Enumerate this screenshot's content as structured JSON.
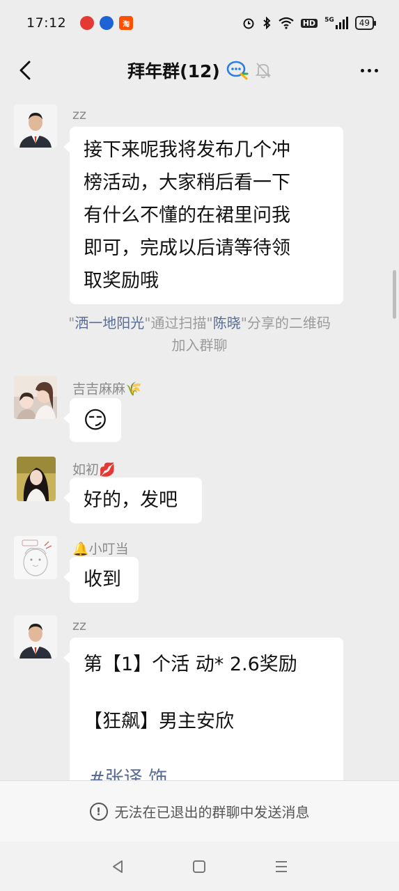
{
  "status_bar": {
    "time": "17:12",
    "battery": "49",
    "signal_label": "5G",
    "hd_label": "HD",
    "app_icon_taobao": "淘"
  },
  "header": {
    "title": "拜年群(12)"
  },
  "messages": [
    {
      "sender": "zz",
      "lines": [
        "接下来呢我将发布几个冲",
        "榜活动，大家稍后看一下",
        "有什么不懂的在裙里问我",
        "即可，完成以后请等待领",
        "取奖励哦"
      ]
    },
    {
      "sender": "吉吉麻麻🌾",
      "emoji": "😏"
    },
    {
      "sender": "如初💋",
      "text": "好的，发吧"
    },
    {
      "sender": "🔔小叮当",
      "text": "收到"
    },
    {
      "sender": "zz",
      "lines": [
        "第【1】个活 动* 2.6奖励",
        "",
        "【狂飙】男主安欣",
        "",
        "#张译  饰"
      ]
    }
  ],
  "system_note": {
    "quote1": "\"",
    "name1": "洒一地阳光",
    "mid1": "\"通过扫描\"",
    "name2": "陈晓",
    "mid2": "\"分享的二维码",
    "line2": "加入群聊"
  },
  "bottom_bar": {
    "text": "无法在已退出的群聊中发送消息",
    "icon_glyph": "!"
  },
  "colors": {
    "bubble": "#ffffff",
    "background": "#ededed",
    "link": "#586b95"
  }
}
